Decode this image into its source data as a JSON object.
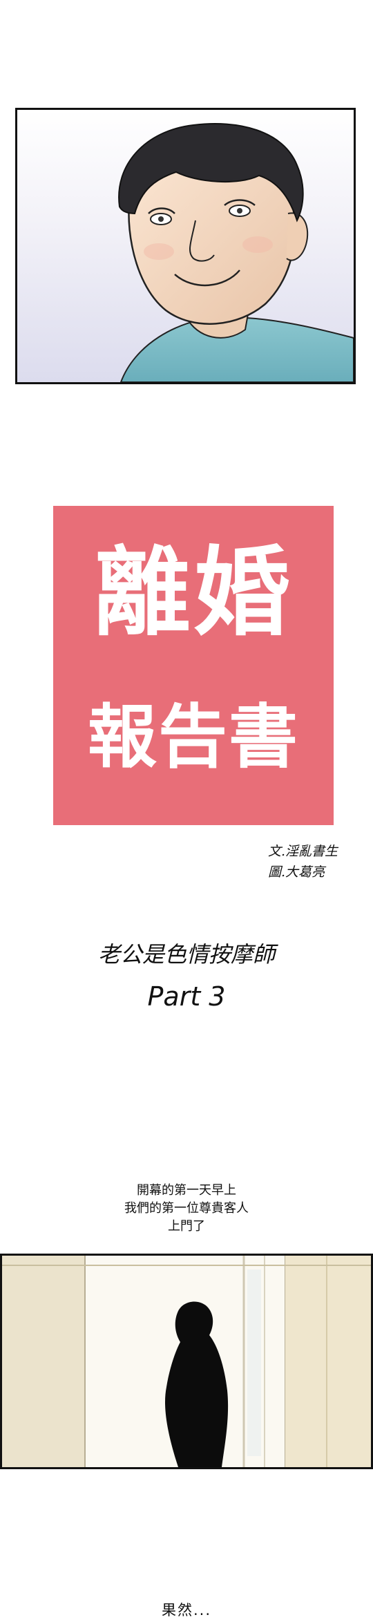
{
  "title": {
    "line1": "離婚",
    "line2": "報告書"
  },
  "credits": {
    "writer": "文.淫亂書生",
    "artist": "圖.大葛亮"
  },
  "episode": {
    "subtitle": "老公是色情按摩師",
    "part": "Part 3"
  },
  "caption": {
    "lines": [
      "開幕的第一天早上",
      "我們的第一位尊貴客人",
      "上門了"
    ]
  },
  "ending_text": "果然...",
  "colors": {
    "title_block": "#e86e78",
    "title_text": "#ffffff",
    "panel_border": "#111111"
  }
}
